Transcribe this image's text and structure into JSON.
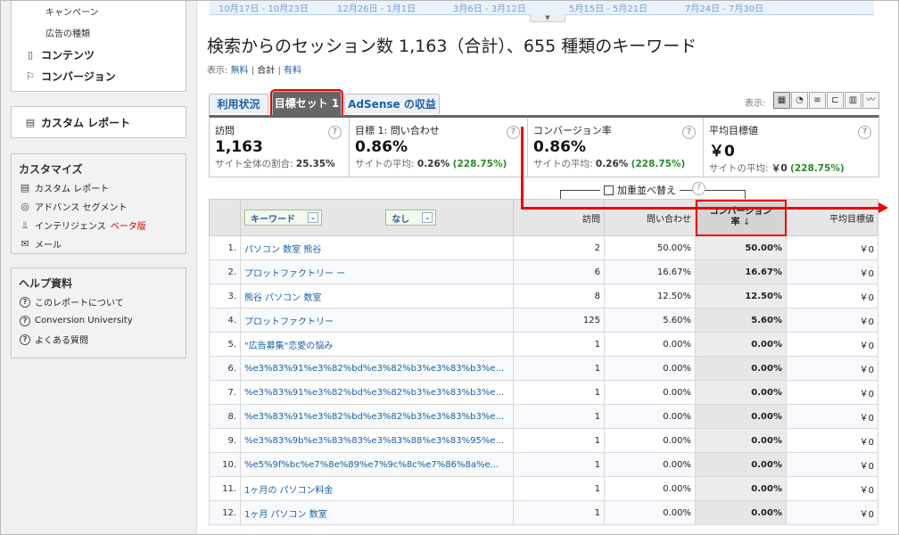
{
  "sidebar": {
    "sub_items": [
      "キャンペーン",
      "広告の種類"
    ],
    "main_items": [
      "コンテンツ",
      "コンバージョン"
    ],
    "custom_report": "カスタム レポート",
    "customize": {
      "title": "カスタマイズ",
      "items": [
        {
          "icon": "report-icon",
          "label": "カスタム レポート"
        },
        {
          "icon": "segment-icon",
          "label": "アドバンス セグメント"
        },
        {
          "icon": "intelligence-icon",
          "label": "インテリジェンス",
          "badge": "ベータ版"
        },
        {
          "icon": "mail-icon",
          "label": "メール"
        }
      ]
    },
    "help": {
      "title": "ヘルプ資料",
      "items": [
        "このレポートについて",
        "Conversion University",
        "よくある質問"
      ]
    }
  },
  "timeline": {
    "labels": [
      "10月17日 - 10月23日",
      "12月26日 - 1月1日",
      "3月6日 - 3月12日",
      "5月15日 - 5月21日",
      "7月24日 - 7月30日"
    ]
  },
  "header": {
    "title": "検索からのセッション数 1,163（合計）、655 種類のキーワード",
    "display_prefix": "表示:",
    "display_links": [
      "無料",
      "合計",
      "有料"
    ]
  },
  "tabs": [
    {
      "label": "利用状況",
      "active": false
    },
    {
      "label": "目標セット 1",
      "active": true
    },
    {
      "label": "AdSense の収益",
      "active": false
    }
  ],
  "view": {
    "label": "表示:",
    "buttons": [
      "table-view-icon",
      "pie-view-icon",
      "performance-view-icon",
      "comparison-view-icon",
      "pivot-view-icon",
      "sparkline-view-icon"
    ]
  },
  "scorecard": [
    {
      "label": "訪問",
      "value": "1,163",
      "sub_prefix": "サイト全体の割合:",
      "sub_value": "25.35%",
      "sub_delta": ""
    },
    {
      "label": "目標 1: 問い合わせ",
      "value": "0.86%",
      "sub_prefix": "サイトの平均:",
      "sub_value": "0.26%",
      "sub_delta": "(228.75%)"
    },
    {
      "label": "コンバージョン率",
      "value": "0.86%",
      "sub_prefix": "サイトの平均:",
      "sub_value": "0.26%",
      "sub_delta": "(228.75%)"
    },
    {
      "label": "平均目標値",
      "value": "￥0",
      "sub_prefix": "サイトの平均:",
      "sub_value": "￥0",
      "sub_delta": "(228.75%)"
    }
  ],
  "weighted_sort": {
    "label": "加重並べ替え"
  },
  "table": {
    "dropdown_primary": "キーワード",
    "dropdown_secondary": "なし",
    "headers": [
      "訪問",
      "問い合わせ",
      "コンバージョン率",
      "平均目標値"
    ],
    "sorted_header_line1": "コンバージョン",
    "sorted_header_line2": "率",
    "rows": [
      {
        "idx": "1.",
        "keyword": "パソコン 数室 熊谷",
        "visits": "2",
        "inquiries": "50.00%",
        "conv": "50.00%",
        "value": "￥0"
      },
      {
        "idx": "2.",
        "keyword": "プロットファクトリー ー",
        "visits": "6",
        "inquiries": "16.67%",
        "conv": "16.67%",
        "value": "￥0"
      },
      {
        "idx": "3.",
        "keyword": "熊谷 パソコン 数室",
        "visits": "8",
        "inquiries": "12.50%",
        "conv": "12.50%",
        "value": "￥0"
      },
      {
        "idx": "4.",
        "keyword": "プロットファクトリー",
        "visits": "125",
        "inquiries": "5.60%",
        "conv": "5.60%",
        "value": "￥0"
      },
      {
        "idx": "5.",
        "keyword": "\"広告募集\"恋愛の悩み",
        "visits": "1",
        "inquiries": "0.00%",
        "conv": "0.00%",
        "value": "￥0"
      },
      {
        "idx": "6.",
        "keyword": "%e3%83%91%e3%82%bd%e3%82%b3%e3%83%b3%e...",
        "visits": "1",
        "inquiries": "0.00%",
        "conv": "0.00%",
        "value": "￥0"
      },
      {
        "idx": "7.",
        "keyword": "%e3%83%91%e3%82%bd%e3%82%b3%e3%83%b3%e...",
        "visits": "1",
        "inquiries": "0.00%",
        "conv": "0.00%",
        "value": "￥0"
      },
      {
        "idx": "8.",
        "keyword": "%e3%83%91%e3%82%bd%e3%82%b3%e3%83%b3%e...",
        "visits": "1",
        "inquiries": "0.00%",
        "conv": "0.00%",
        "value": "￥0"
      },
      {
        "idx": "9.",
        "keyword": "%e3%83%9b%e3%83%83%e3%83%88%e3%83%95%e...",
        "visits": "1",
        "inquiries": "0.00%",
        "conv": "0.00%",
        "value": "￥0"
      },
      {
        "idx": "10.",
        "keyword": "%e5%9f%bc%e7%8e%89%e7%9c%8c%e7%86%8a%e...",
        "visits": "1",
        "inquiries": "0.00%",
        "conv": "0.00%",
        "value": "￥0"
      },
      {
        "idx": "11.",
        "keyword": "1ヶ月の パソコン料金",
        "visits": "1",
        "inquiries": "0.00%",
        "conv": "0.00%",
        "value": "￥0"
      },
      {
        "idx": "12.",
        "keyword": "1ヶ月 パソコン 数室",
        "visits": "1",
        "inquiries": "0.00%",
        "conv": "0.00%",
        "value": "￥0"
      }
    ]
  },
  "colors": {
    "annotation": "#e00000",
    "link": "#1a5fa8",
    "positive": "#2a8a2a"
  }
}
